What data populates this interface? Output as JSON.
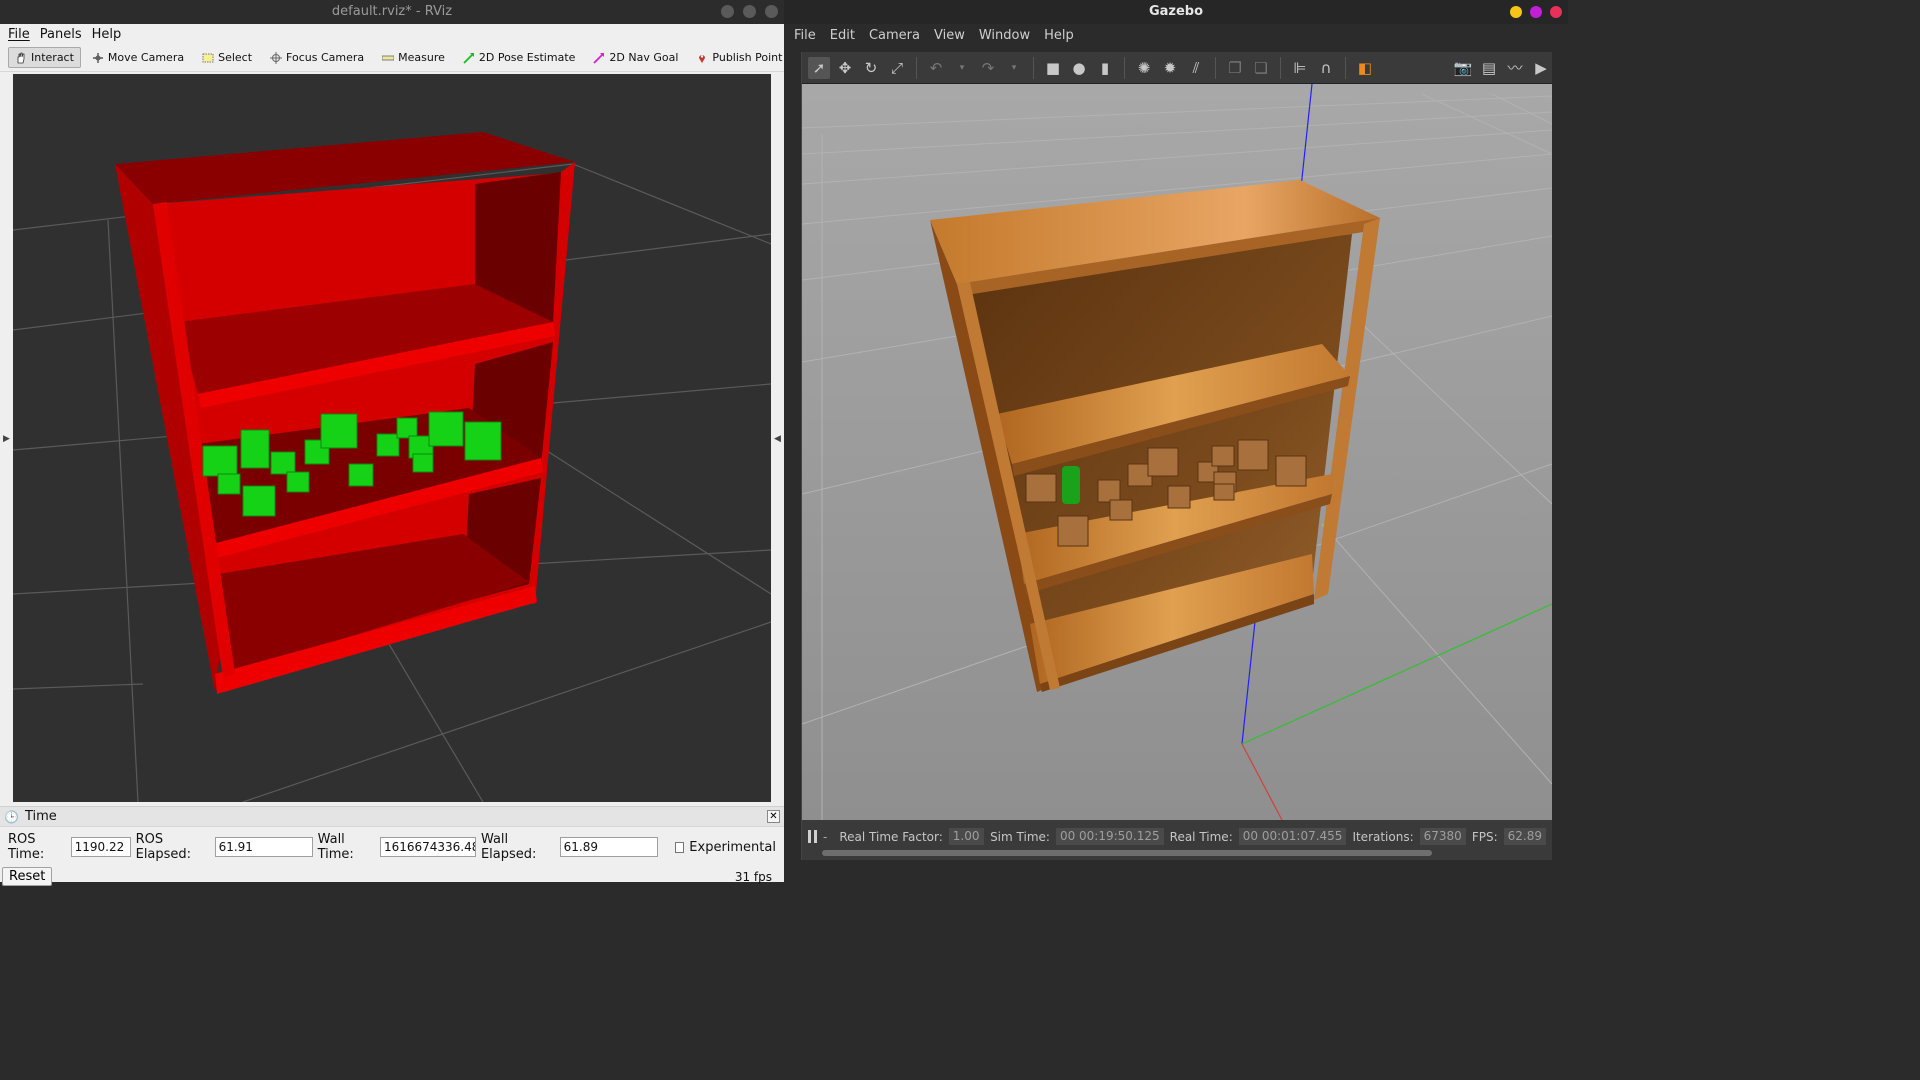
{
  "rviz": {
    "title": "default.rviz* - RViz",
    "menu": [
      "File",
      "Panels",
      "Help"
    ],
    "tools": [
      {
        "label": "Interact",
        "icon": "hand-icon",
        "active": true
      },
      {
        "label": "Move Camera",
        "icon": "move-camera-icon"
      },
      {
        "label": "Select",
        "icon": "select-box-icon"
      },
      {
        "label": "Focus Camera",
        "icon": "focus-camera-icon"
      },
      {
        "label": "Measure",
        "icon": "ruler-icon"
      },
      {
        "label": "2D Pose Estimate",
        "icon": "green-arrow-icon"
      },
      {
        "label": "2D Nav Goal",
        "icon": "magenta-arrow-icon"
      },
      {
        "label": "Publish Point",
        "icon": "map-pin-icon"
      }
    ],
    "colors": {
      "shelf": "#d40000",
      "shelf_dark": "#7a0000",
      "cubes": "#10e010",
      "grid": "#5a5a5a",
      "background": "#303030"
    },
    "time_panel": {
      "title": "Time",
      "ros_time_label": "ROS Time:",
      "ros_time": "1190.22",
      "ros_elapsed_label": "ROS Elapsed:",
      "ros_elapsed": "61.91",
      "wall_time_label": "Wall Time:",
      "wall_time": "1616674336.48",
      "wall_elapsed_label": "Wall Elapsed:",
      "wall_elapsed": "61.89",
      "experimental_label": "Experimental",
      "reset_label": "Reset",
      "fps": "31 fps"
    }
  },
  "gazebo": {
    "title": "Gazebo",
    "menu": [
      "File",
      "Edit",
      "Camera",
      "View",
      "Window",
      "Help"
    ],
    "colors": {
      "wood": "#c47a2c",
      "wood_dark": "#6e3d12",
      "ground": "#9a9a9a",
      "z_axis": "#2020ff",
      "y_axis": "#30c030",
      "x_axis": "#d04040"
    },
    "status": {
      "real_time_factor_label": "Real Time Factor:",
      "real_time_factor": "1.00",
      "sim_time_label": "Sim Time:",
      "sim_time": "00 00:19:50.125",
      "real_time_label": "Real Time:",
      "real_time": "00 00:01:07.455",
      "iterations_label": "Iterations:",
      "iterations": "67380",
      "fps_label": "FPS:",
      "fps": "62.89"
    }
  }
}
